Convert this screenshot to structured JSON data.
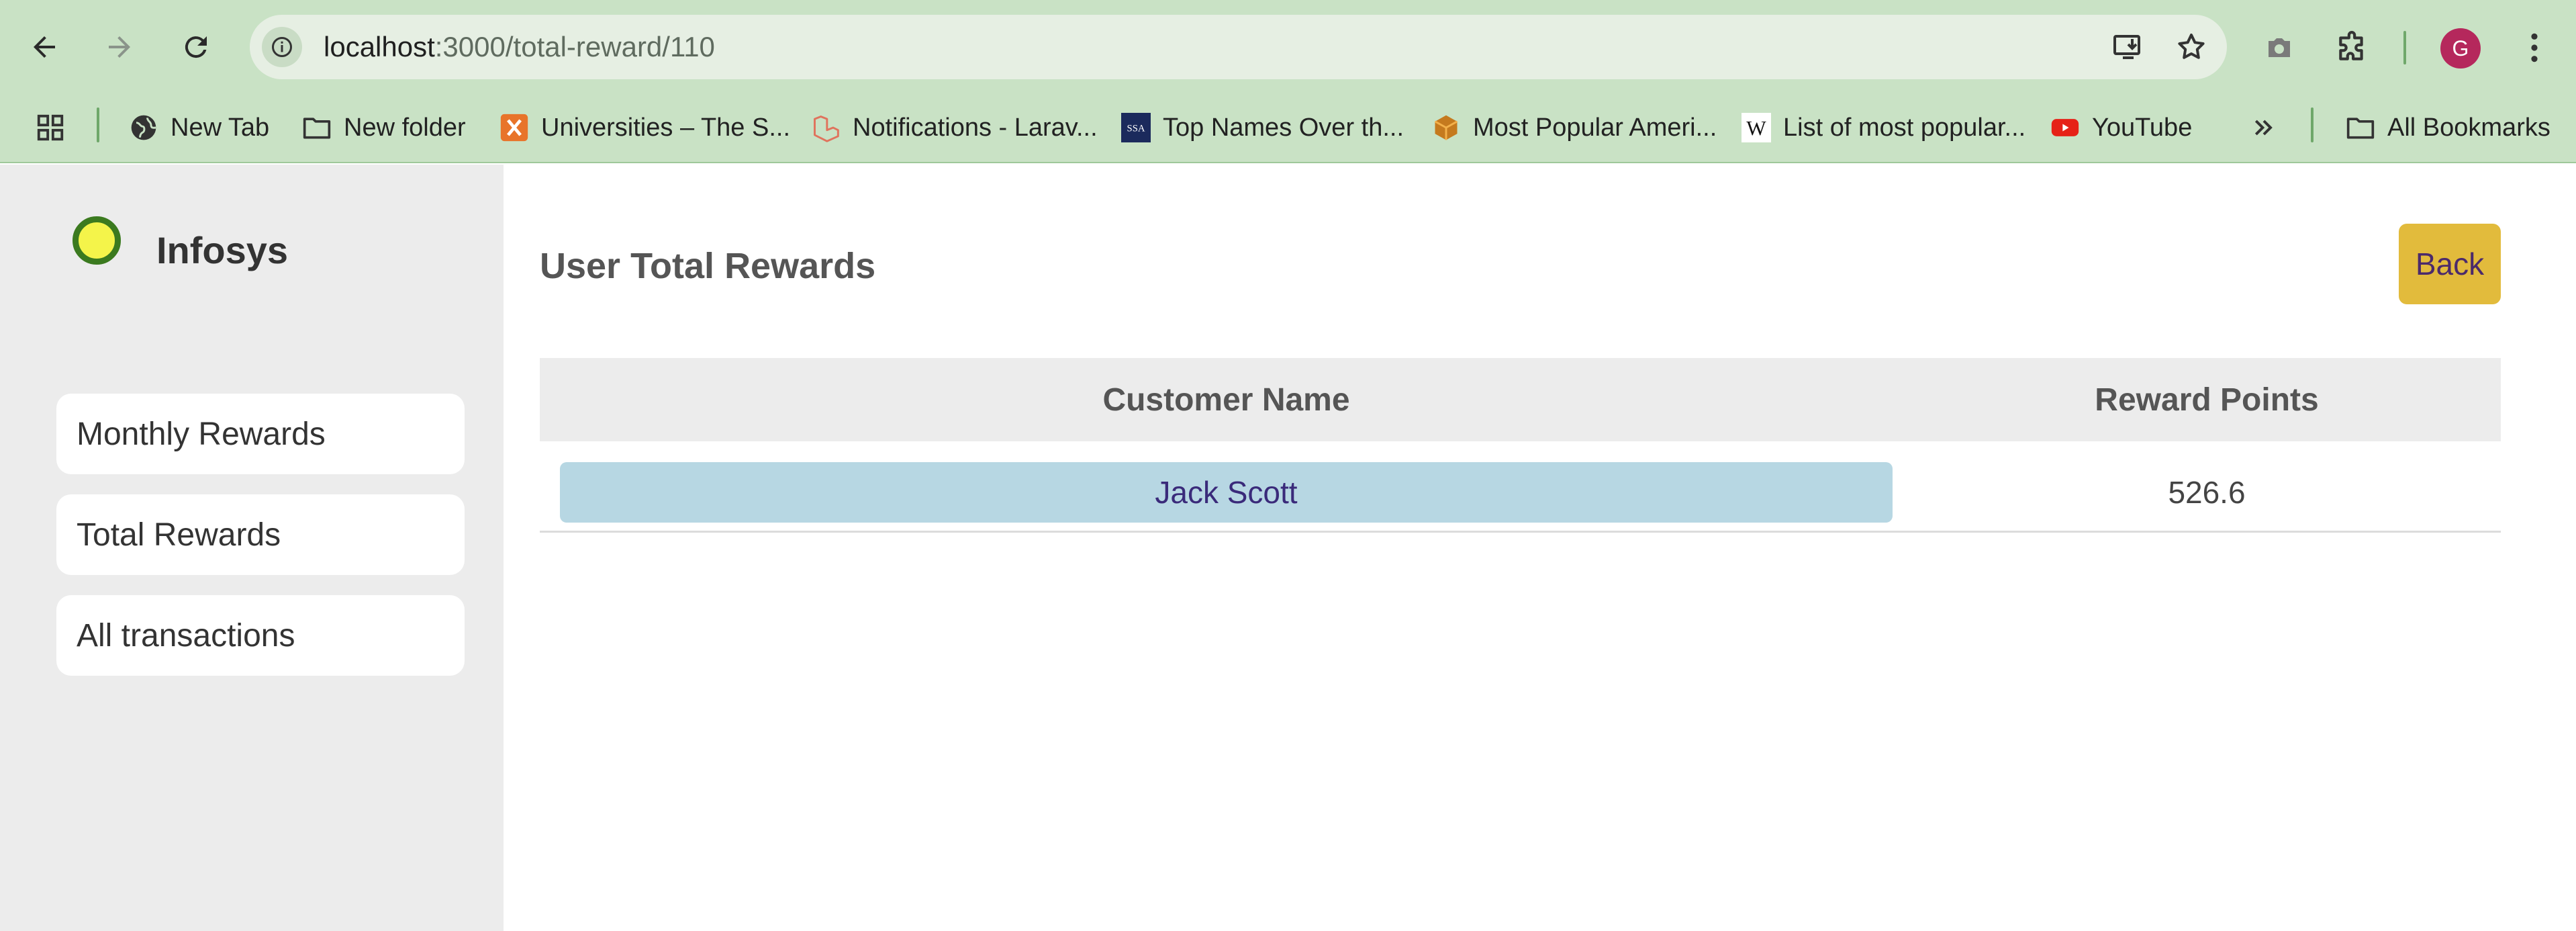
{
  "browser": {
    "url_host": "localhost",
    "url_rest": ":3000/total-reward/110",
    "profile_initial": "G",
    "bookmarks": [
      {
        "label": "New Tab",
        "icon": "globe-icon"
      },
      {
        "label": "New folder",
        "icon": "folder-icon"
      },
      {
        "label": "Universities – The S...",
        "icon": "xampp-icon"
      },
      {
        "label": "Notifications - Larav...",
        "icon": "laravel-icon"
      },
      {
        "label": "Top Names Over th...",
        "icon": "ssa-icon"
      },
      {
        "label": "Most Popular Ameri...",
        "icon": "box-icon"
      },
      {
        "label": "List of most popular...",
        "icon": "wikipedia-icon"
      },
      {
        "label": "YouTube",
        "icon": "youtube-icon"
      }
    ],
    "all_bookmarks_label": "All Bookmarks"
  },
  "sidebar": {
    "brand": "Infosys",
    "items": [
      {
        "label": "Monthly Rewards"
      },
      {
        "label": "Total Rewards"
      },
      {
        "label": "All transactions"
      }
    ]
  },
  "main": {
    "title": "User Total Rewards",
    "back_label": "Back",
    "table": {
      "headers": [
        "Customer Name",
        "Reward Points"
      ],
      "rows": [
        {
          "name": "Jack Scott",
          "points": "526.6"
        }
      ]
    }
  },
  "colors": {
    "chrome": "#c9e2c5",
    "back_button": "#e2bb3c",
    "name_cell": "#b7d7e3",
    "logo_fill": "#f4f44a",
    "logo_ring": "#3b7a1f"
  }
}
